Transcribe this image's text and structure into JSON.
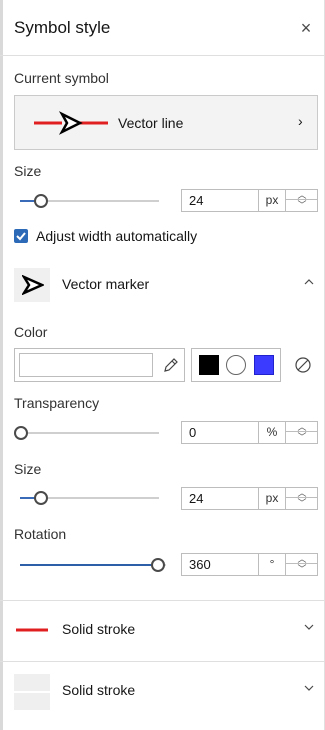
{
  "header": {
    "title": "Symbol style",
    "close_glyph": "×"
  },
  "current_symbol": {
    "label": "Current symbol",
    "name": "Vector line",
    "chevron": "›",
    "line_color": "#e02020"
  },
  "line_size": {
    "label": "Size",
    "value": "24",
    "unit": "px",
    "slider_fraction": 0.14
  },
  "adjust_width": {
    "label": "Adjust width automatically",
    "checked": true
  },
  "vector_marker": {
    "label": "Vector marker",
    "chevron": "^",
    "expanded": true
  },
  "color": {
    "label": "Color",
    "current": "#ffffff",
    "quick_colors": [
      "#000000",
      "#ffffff",
      "#3b3bff"
    ]
  },
  "transparency": {
    "label": "Transparency",
    "value": "0",
    "unit": "%",
    "slider_fraction": 0.0
  },
  "marker_size": {
    "label": "Size",
    "value": "24",
    "unit": "px",
    "slider_fraction": 0.14
  },
  "rotation": {
    "label": "Rotation",
    "value": "360",
    "unit": "°",
    "slider_fraction": 1.0
  },
  "strokes": [
    {
      "label": "Solid stroke",
      "chevron": "⌄",
      "swatch": "#e02020"
    },
    {
      "label": "Solid stroke",
      "chevron": "⌄",
      "swatch": "#eeeeee"
    }
  ],
  "icons": {
    "close": "close-icon",
    "chevron_right": "chevron-right-icon",
    "pencil": "pencil-icon",
    "no_color": "no-color-icon"
  }
}
